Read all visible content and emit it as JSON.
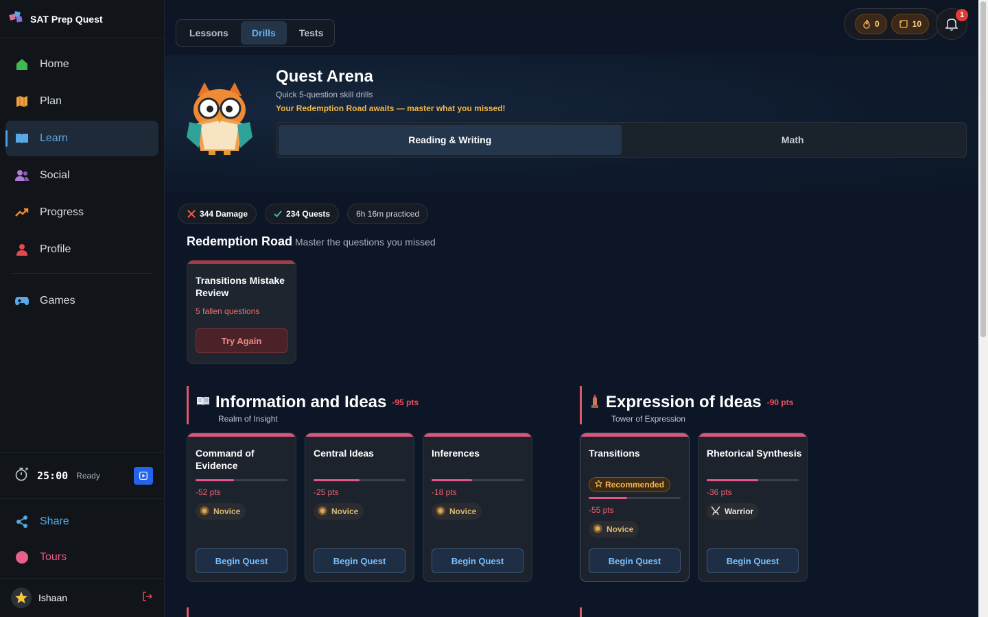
{
  "app": {
    "name": "SAT Prep Quest"
  },
  "sidebar": {
    "items": [
      {
        "label": "Home",
        "icon": "home-icon",
        "color": "#3fb950"
      },
      {
        "label": "Plan",
        "icon": "map-icon",
        "color": "#f0a040"
      },
      {
        "label": "Learn",
        "icon": "book-icon",
        "color": "#5aa9e6",
        "active": true
      },
      {
        "label": "Social",
        "icon": "users-icon",
        "color": "#b07ad8"
      },
      {
        "label": "Progress",
        "icon": "trend-icon",
        "color": "#f08a30"
      },
      {
        "label": "Profile",
        "icon": "user-icon",
        "color": "#e5484d"
      },
      {
        "label": "Games",
        "icon": "gamepad-icon",
        "color": "#5aa9e6"
      }
    ],
    "timer": {
      "value": "25:00",
      "status": "Ready"
    },
    "bottom": [
      {
        "label": "Share",
        "icon": "share-icon",
        "color": "#5aa9e6"
      },
      {
        "label": "Tours",
        "icon": "circle-icon",
        "color": "#e6608a"
      }
    ],
    "user": {
      "name": "Ishaan"
    }
  },
  "modes": {
    "tabs": [
      "Lessons",
      "Drills",
      "Tests"
    ],
    "active": "Drills"
  },
  "header_stats": {
    "streak": "0",
    "tickets": "10",
    "notifications": "1"
  },
  "hero": {
    "title": "Quest Arena",
    "subtitle": "Quick 5-question skill drills",
    "promo": "Your Redemption Road awaits — master what you missed!",
    "subjects": [
      "Reading & Writing",
      "Math"
    ],
    "active_subject": "Reading & Writing"
  },
  "badges": {
    "damage": "344 Damage",
    "quests": "234 Quests",
    "time": "6h 16m practiced"
  },
  "redemption": {
    "title": "Redemption Road",
    "subtitle": "Master the questions you missed",
    "card": {
      "title": "Transitions Mistake Review",
      "sub": "5 fallen questions",
      "button": "Try Again"
    }
  },
  "sections": [
    {
      "icon": "book-icon",
      "title": "Information and Ideas",
      "pts": "-95 pts",
      "sub": "Realm of Insight",
      "cards": [
        {
          "title": "Command of Evidence",
          "progress": 0.42,
          "pts": "-52 pts",
          "rank": "Novice",
          "button": "Begin Quest"
        },
        {
          "title": "Central Ideas",
          "progress": 0.5,
          "pts": "-25 pts",
          "rank": "Novice",
          "button": "Begin Quest"
        },
        {
          "title": "Inferences",
          "progress": 0.44,
          "pts": "-18 pts",
          "rank": "Novice",
          "button": "Begin Quest"
        }
      ]
    },
    {
      "icon": "tower-icon",
      "title": "Expression of Ideas",
      "pts": "-90 pts",
      "sub": "Tower of Expression",
      "cards": [
        {
          "title": "Transitions",
          "recommended": "Recommended",
          "progress": 0.42,
          "pts": "-55 pts",
          "rank": "Novice",
          "button": "Begin Quest"
        },
        {
          "title": "Rhetorical Synthesis",
          "progress": 0.56,
          "pts": "-36 pts",
          "rank": "Warrior",
          "button": "Begin Quest"
        }
      ]
    }
  ]
}
